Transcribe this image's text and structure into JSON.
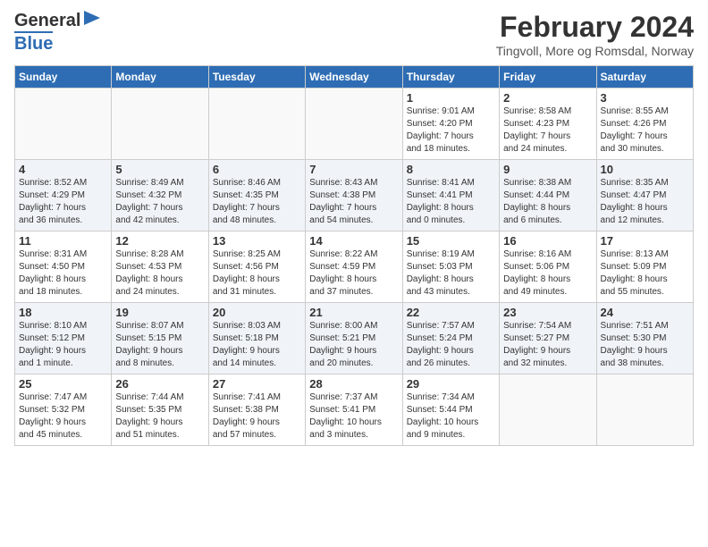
{
  "header": {
    "logo_line1": "General",
    "logo_line2": "Blue",
    "month": "February 2024",
    "location": "Tingvoll, More og Romsdal, Norway"
  },
  "days_of_week": [
    "Sunday",
    "Monday",
    "Tuesday",
    "Wednesday",
    "Thursday",
    "Friday",
    "Saturday"
  ],
  "weeks": [
    [
      {
        "day": "",
        "info": ""
      },
      {
        "day": "",
        "info": ""
      },
      {
        "day": "",
        "info": ""
      },
      {
        "day": "",
        "info": ""
      },
      {
        "day": "1",
        "info": "Sunrise: 9:01 AM\nSunset: 4:20 PM\nDaylight: 7 hours\nand 18 minutes."
      },
      {
        "day": "2",
        "info": "Sunrise: 8:58 AM\nSunset: 4:23 PM\nDaylight: 7 hours\nand 24 minutes."
      },
      {
        "day": "3",
        "info": "Sunrise: 8:55 AM\nSunset: 4:26 PM\nDaylight: 7 hours\nand 30 minutes."
      }
    ],
    [
      {
        "day": "4",
        "info": "Sunrise: 8:52 AM\nSunset: 4:29 PM\nDaylight: 7 hours\nand 36 minutes."
      },
      {
        "day": "5",
        "info": "Sunrise: 8:49 AM\nSunset: 4:32 PM\nDaylight: 7 hours\nand 42 minutes."
      },
      {
        "day": "6",
        "info": "Sunrise: 8:46 AM\nSunset: 4:35 PM\nDaylight: 7 hours\nand 48 minutes."
      },
      {
        "day": "7",
        "info": "Sunrise: 8:43 AM\nSunset: 4:38 PM\nDaylight: 7 hours\nand 54 minutes."
      },
      {
        "day": "8",
        "info": "Sunrise: 8:41 AM\nSunset: 4:41 PM\nDaylight: 8 hours\nand 0 minutes."
      },
      {
        "day": "9",
        "info": "Sunrise: 8:38 AM\nSunset: 4:44 PM\nDaylight: 8 hours\nand 6 minutes."
      },
      {
        "day": "10",
        "info": "Sunrise: 8:35 AM\nSunset: 4:47 PM\nDaylight: 8 hours\nand 12 minutes."
      }
    ],
    [
      {
        "day": "11",
        "info": "Sunrise: 8:31 AM\nSunset: 4:50 PM\nDaylight: 8 hours\nand 18 minutes."
      },
      {
        "day": "12",
        "info": "Sunrise: 8:28 AM\nSunset: 4:53 PM\nDaylight: 8 hours\nand 24 minutes."
      },
      {
        "day": "13",
        "info": "Sunrise: 8:25 AM\nSunset: 4:56 PM\nDaylight: 8 hours\nand 31 minutes."
      },
      {
        "day": "14",
        "info": "Sunrise: 8:22 AM\nSunset: 4:59 PM\nDaylight: 8 hours\nand 37 minutes."
      },
      {
        "day": "15",
        "info": "Sunrise: 8:19 AM\nSunset: 5:03 PM\nDaylight: 8 hours\nand 43 minutes."
      },
      {
        "day": "16",
        "info": "Sunrise: 8:16 AM\nSunset: 5:06 PM\nDaylight: 8 hours\nand 49 minutes."
      },
      {
        "day": "17",
        "info": "Sunrise: 8:13 AM\nSunset: 5:09 PM\nDaylight: 8 hours\nand 55 minutes."
      }
    ],
    [
      {
        "day": "18",
        "info": "Sunrise: 8:10 AM\nSunset: 5:12 PM\nDaylight: 9 hours\nand 1 minute."
      },
      {
        "day": "19",
        "info": "Sunrise: 8:07 AM\nSunset: 5:15 PM\nDaylight: 9 hours\nand 8 minutes."
      },
      {
        "day": "20",
        "info": "Sunrise: 8:03 AM\nSunset: 5:18 PM\nDaylight: 9 hours\nand 14 minutes."
      },
      {
        "day": "21",
        "info": "Sunrise: 8:00 AM\nSunset: 5:21 PM\nDaylight: 9 hours\nand 20 minutes."
      },
      {
        "day": "22",
        "info": "Sunrise: 7:57 AM\nSunset: 5:24 PM\nDaylight: 9 hours\nand 26 minutes."
      },
      {
        "day": "23",
        "info": "Sunrise: 7:54 AM\nSunset: 5:27 PM\nDaylight: 9 hours\nand 32 minutes."
      },
      {
        "day": "24",
        "info": "Sunrise: 7:51 AM\nSunset: 5:30 PM\nDaylight: 9 hours\nand 38 minutes."
      }
    ],
    [
      {
        "day": "25",
        "info": "Sunrise: 7:47 AM\nSunset: 5:32 PM\nDaylight: 9 hours\nand 45 minutes."
      },
      {
        "day": "26",
        "info": "Sunrise: 7:44 AM\nSunset: 5:35 PM\nDaylight: 9 hours\nand 51 minutes."
      },
      {
        "day": "27",
        "info": "Sunrise: 7:41 AM\nSunset: 5:38 PM\nDaylight: 9 hours\nand 57 minutes."
      },
      {
        "day": "28",
        "info": "Sunrise: 7:37 AM\nSunset: 5:41 PM\nDaylight: 10 hours\nand 3 minutes."
      },
      {
        "day": "29",
        "info": "Sunrise: 7:34 AM\nSunset: 5:44 PM\nDaylight: 10 hours\nand 9 minutes."
      },
      {
        "day": "",
        "info": ""
      },
      {
        "day": "",
        "info": ""
      }
    ]
  ]
}
